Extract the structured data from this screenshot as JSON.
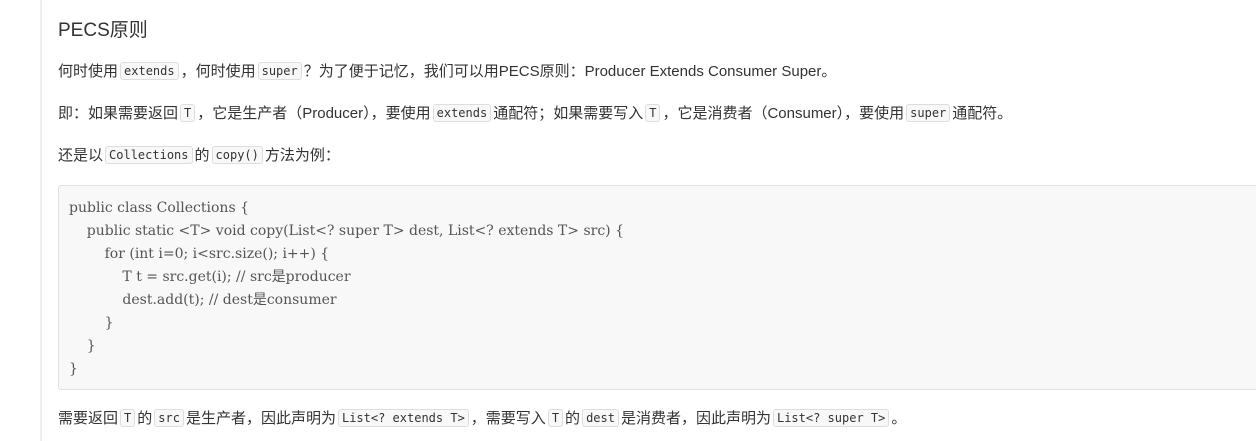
{
  "heading": "PECS原则",
  "p1": {
    "t1": "何时使用",
    "c1": "extends",
    "t2": "，何时使用",
    "c2": "super",
    "t3": "？为了便于记忆，我们可以用PECS原则：Producer Extends Consumer Super。"
  },
  "p2": {
    "t1": "即：如果需要返回",
    "c1": "T",
    "t2": "，它是生产者（Producer），要使用",
    "c2": "extends",
    "t3": "通配符；如果需要写入",
    "c3": "T",
    "t4": "，它是消费者（Consumer），要使用",
    "c4": "super",
    "t5": "通配符。"
  },
  "p3": {
    "t1": "还是以",
    "c1": "Collections",
    "t2": "的",
    "c2": "copy()",
    "t3": "方法为例："
  },
  "code_lines": [
    "public class Collections {",
    "    public static <T> void copy(List<? super T> dest, List<? extends T> src) {",
    "        for (int i=0; i<src.size(); i++) {",
    "            T t = src.get(i); // src是producer",
    "            dest.add(t); // dest是consumer",
    "        }",
    "    }",
    "}"
  ],
  "p4": {
    "t1": "需要返回",
    "c1": "T",
    "t2": "的",
    "c2": "src",
    "t3": "是生产者，因此声明为",
    "c3": "List<? extends T>",
    "t4": "，需要写入",
    "c4": "T",
    "t5": "的",
    "c5": "dest",
    "t6": "是消费者，因此声明为",
    "c6": "List<? super T>",
    "t7": "。"
  }
}
